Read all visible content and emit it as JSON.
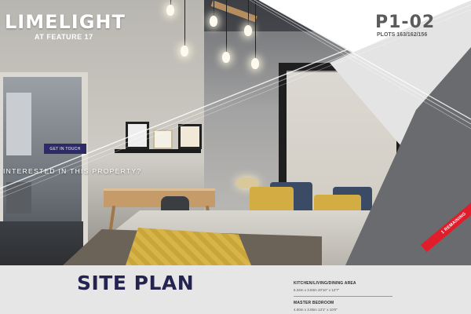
{
  "hero": {
    "brand": "LIMELIGHT",
    "brand_sub": "AT FEATURE 17",
    "plot_code": "P1-02",
    "plot_numbers": "PLOTS 163/162/156",
    "cta_label": "GET IN TOUCH",
    "interest_text": "INTERESTED IN THIS PROPERTY?",
    "ribbon_text": "1 REMAINING"
  },
  "site_plan": {
    "title": "SITE PLAN",
    "rooms": [
      {
        "name": "KITCHEN/LIVING/DINING AREA",
        "dimensions": "6.34m x 3.83m 20'10\" x 12'7\""
      },
      {
        "name": "MASTER BEDROOM",
        "dimensions": "4.00m x 3.05m 13'1\" x 10'0\""
      }
    ]
  },
  "colors": {
    "brand_navy": "#25244f",
    "button_navy": "#2d2a66",
    "ribbon_red": "#e21d2b",
    "accent_grey": "#5b5b5b"
  }
}
